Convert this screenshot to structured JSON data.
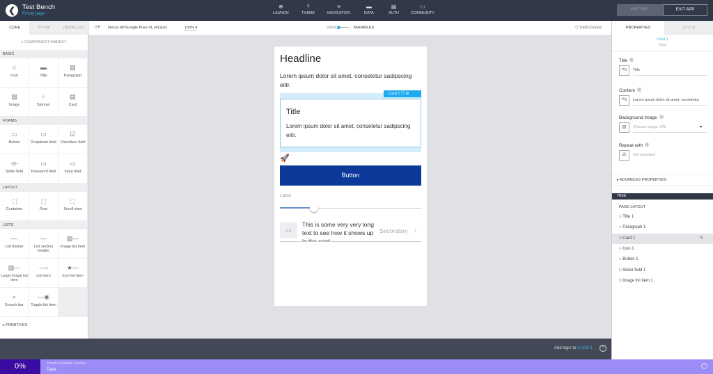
{
  "header": {
    "title": "Test Bench",
    "subtitle": "Empty page",
    "nav": [
      {
        "label": "LAUNCH",
        "icon": "launch-icon",
        "glyph": "⊕"
      },
      {
        "label": "THEME",
        "icon": "theme-icon",
        "glyph": "†"
      },
      {
        "label": "NAVIGATION",
        "icon": "navigation-icon",
        "glyph": "≡"
      },
      {
        "label": "DATA",
        "icon": "folder-icon",
        "glyph": "▬"
      },
      {
        "label": "AUTH",
        "icon": "auth-icon",
        "glyph": "▤"
      },
      {
        "label": "COMMUNITY",
        "icon": "chat-icon",
        "glyph": "▭"
      }
    ],
    "history": "HISTORY",
    "exit": "EXIT APP"
  },
  "left": {
    "tabs": [
      "CORE",
      "BY ME",
      "INSTALLED"
    ],
    "market": "COMPONENT MARKET",
    "sections": [
      {
        "title": "BASIC",
        "items": [
          [
            "Icon",
            "☆"
          ],
          [
            "Title",
            "▬"
          ],
          [
            "Paragraph",
            "▤"
          ],
          [
            "Image",
            "▨"
          ],
          [
            "Spinner",
            "⁘"
          ],
          [
            "Card",
            "▤"
          ]
        ]
      },
      {
        "title": "FORMS",
        "items": [
          [
            "Button",
            "▭"
          ],
          [
            "Dropdown field",
            "▭"
          ],
          [
            "Checkbox field",
            "☑"
          ],
          [
            "Slider field",
            "-o-"
          ],
          [
            "Password field",
            "▭"
          ],
          [
            "Input field",
            "▭"
          ]
        ]
      },
      {
        "title": "LAYOUT",
        "items": [
          [
            "Container",
            "⬚"
          ],
          [
            "Row",
            "⬚"
          ],
          [
            "Scroll view",
            "⬚"
          ]
        ]
      },
      {
        "title": "LISTS",
        "items": [
          [
            "List divider",
            "—"
          ],
          [
            "List section header",
            "—"
          ],
          [
            "Image list item",
            "▨—"
          ],
          [
            "Large image list item",
            "▨—"
          ],
          [
            "List item",
            "—›"
          ],
          [
            "Icon list item",
            "★—"
          ],
          [
            "Search bar",
            "⌕"
          ],
          [
            "Toggle list item",
            "—◉"
          ]
        ]
      }
    ],
    "primitives": "PRIMITIVES"
  },
  "toolbar": {
    "device": "Nexus 6P/Google Pixel XL (412px)",
    "zoom": "100%",
    "view": "VIEW",
    "variables": "VARIABLES",
    "debugger": "DEBUGGER"
  },
  "phone": {
    "headline": "Headline",
    "paragraph": "Lorem ipsum dolor sit amet, consetetur sadipscing elitr.",
    "card_badge": "Card 1",
    "card_title": "Title",
    "card_text": "Lorem ipsum dolor sit amet, consetetur sadipscing elitr.",
    "button": "Button",
    "slider_label": "Label",
    "slider_value": 0.24,
    "list_text": "This is some very very long text to see how it shows up in the card",
    "list_secondary": "Secondary"
  },
  "right": {
    "tabs": [
      "PROPERTIES",
      "STYLE"
    ],
    "selected_name": "Card 1",
    "selected_type": "Card",
    "props": [
      {
        "label": "Title",
        "value": "Title"
      },
      {
        "label": "Content",
        "value": "Lorem ipsum dolor sit amet, consetetur"
      },
      {
        "label": "Background Image",
        "placeholder": "Choose image URL"
      },
      {
        "label": "Repeat with",
        "placeholder": "Not repeated"
      }
    ],
    "advanced": "ADVANCED PROPERTIES",
    "tree_header": "TREE",
    "tree_root": "PAGE LAYOUT",
    "tree": [
      {
        "label": "Title 1",
        "m": "○"
      },
      {
        "label": "Paragraph 1",
        "m": "○"
      },
      {
        "label": "Card 1",
        "m": "□",
        "selected": true
      },
      {
        "label": "Icon 1",
        "m": "○"
      },
      {
        "label": "Button 1",
        "m": "○"
      },
      {
        "label": "Slider field 1",
        "m": "□"
      },
      {
        "label": "Image list item 1",
        "m": "□"
      }
    ]
  },
  "logic": {
    "prefix": "Add logic to",
    "target": "CARD 1"
  },
  "learning": {
    "percent": "0%",
    "title": "YOUR LEARNING STATUS",
    "topic": "Data"
  },
  "colors": {
    "accent": "#3ab0e0",
    "button": "#0d3a9a",
    "learn": "#9b8cf8",
    "learn_dark": "#3a0ca3",
    "topbar": "#313848"
  }
}
